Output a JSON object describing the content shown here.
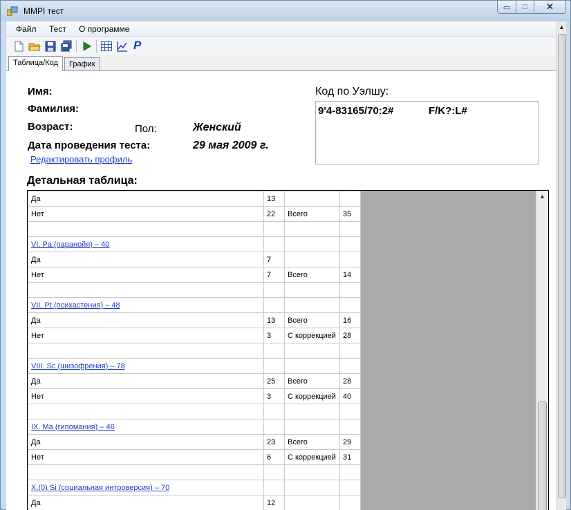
{
  "window": {
    "title": "MMPI тест",
    "min_glyph": "▭",
    "max_glyph": "□",
    "close_glyph": "✕"
  },
  "menu": {
    "items": [
      "Файл",
      "Тест",
      "О программе"
    ]
  },
  "toolbar": {
    "buttons": [
      "new-file-icon",
      "open-folder-icon",
      "save-icon",
      "save-all-icon",
      "play-icon",
      "table-view-icon",
      "chart-icon",
      "p-letter-icon"
    ],
    "p_label": "P",
    "colors": {
      "play": "#1c8c1c",
      "p": "#1f3cc0"
    }
  },
  "tabs": [
    {
      "label": "Таблица/Код",
      "active": true
    },
    {
      "label": "График",
      "active": false
    }
  ],
  "profile": {
    "name_label": "Имя:",
    "surname_label": "Фамилия:",
    "age_label": "Возраст:",
    "sex_label": "Пол:",
    "sex_value": "Женский",
    "date_label": "Дата проведения теста:",
    "date_value": "29 мая 2009 г.",
    "edit_link": "Редактировать профиль"
  },
  "welsh": {
    "label": "Код по Уэлшу:",
    "code_main": "9'4-83165/70:2#",
    "code_sec": "F/K?:L#"
  },
  "table": {
    "title": "Детальная таблица:",
    "rows": [
      {
        "c1": "Да",
        "c2": "13",
        "c3": "",
        "c4": ""
      },
      {
        "c1": "Нет",
        "c2": "22",
        "c3": "Всего",
        "c4": "35"
      },
      {
        "c1": "",
        "c2": "",
        "c3": "",
        "c4": ""
      },
      {
        "c1": "VI. Pa (паранойя) – 40",
        "c2": "",
        "c3": "",
        "c4": "",
        "link": true
      },
      {
        "c1": "Да",
        "c2": "7",
        "c3": "",
        "c4": ""
      },
      {
        "c1": "Нет",
        "c2": "7",
        "c3": "Всего",
        "c4": "14"
      },
      {
        "c1": "",
        "c2": "",
        "c3": "",
        "c4": ""
      },
      {
        "c1": "VII. Pt (психастения) – 48",
        "c2": "",
        "c3": "",
        "c4": "",
        "link": true
      },
      {
        "c1": "Да",
        "c2": "13",
        "c3": "Всего",
        "c4": "16"
      },
      {
        "c1": "Нет",
        "c2": "3",
        "c3": "С коррекцией",
        "c4": "28"
      },
      {
        "c1": "",
        "c2": "",
        "c3": "",
        "c4": ""
      },
      {
        "c1": "VIII. Sc (шизофрения) – 78",
        "c2": "",
        "c3": "",
        "c4": "",
        "link": true
      },
      {
        "c1": "Да",
        "c2": "25",
        "c3": "Всего",
        "c4": "28"
      },
      {
        "c1": "Нет",
        "c2": "3",
        "c3": "С коррекцией",
        "c4": "40"
      },
      {
        "c1": "",
        "c2": "",
        "c3": "",
        "c4": ""
      },
      {
        "c1": "IX. Ma (гипомания) – 46",
        "c2": "",
        "c3": "",
        "c4": "",
        "link": true
      },
      {
        "c1": "Да",
        "c2": "23",
        "c3": "Всего",
        "c4": "29"
      },
      {
        "c1": "Нет",
        "c2": "6",
        "c3": "С коррекцией",
        "c4": "31"
      },
      {
        "c1": "",
        "c2": "",
        "c3": "",
        "c4": ""
      },
      {
        "c1": "X.(0) Si (социальная интроверсия) – 70",
        "c2": "",
        "c3": "",
        "c4": "",
        "link": true
      },
      {
        "c1": "Да",
        "c2": "12",
        "c3": "",
        "c4": ""
      },
      {
        "c1": "",
        "c2": "",
        "c3": "",
        "c4": ""
      }
    ]
  }
}
